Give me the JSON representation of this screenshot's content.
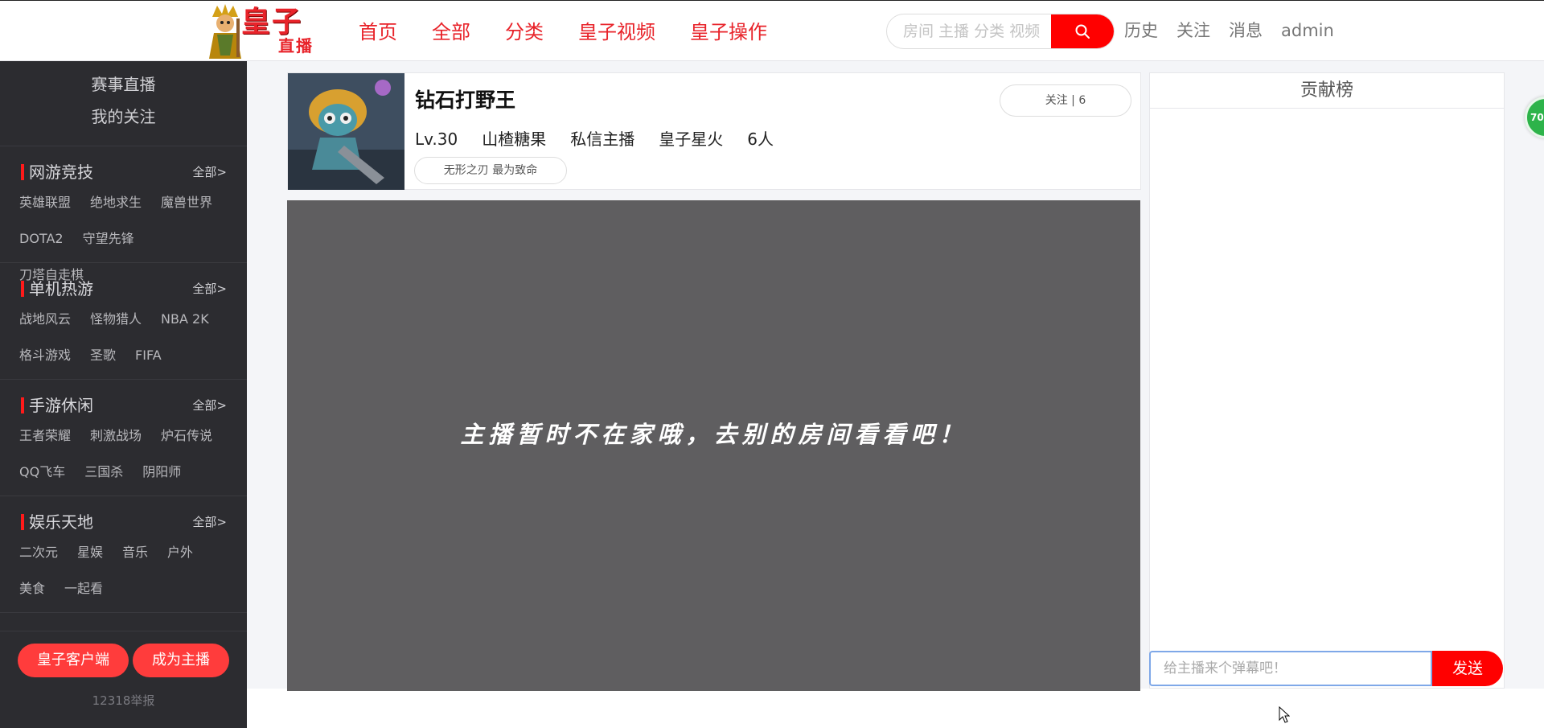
{
  "header": {
    "logo_text_big": "皇子",
    "logo_text_small": "直播",
    "nav": [
      "首页",
      "全部",
      "分类",
      "皇子视频",
      "皇子操作"
    ],
    "search_placeholder": "房间 主播 分类 视频",
    "user_links": [
      "历史",
      "关注",
      "消息",
      "admin"
    ]
  },
  "sidebar": {
    "top_items": [
      "赛事直播",
      "我的关注"
    ],
    "sections": [
      {
        "title": "网游竞技",
        "all_label": "全部>",
        "games": [
          "英雄联盟",
          "绝地求生",
          "魔兽世界",
          "DOTA2",
          "守望先锋",
          "刀塔自走棋"
        ]
      },
      {
        "title": "单机热游",
        "all_label": "全部>",
        "games": [
          "战地风云",
          "怪物猎人",
          "NBA 2K",
          "格斗游戏",
          "圣歌",
          "FIFA"
        ]
      },
      {
        "title": "手游休闲",
        "all_label": "全部>",
        "games": [
          "王者荣耀",
          "刺激战场",
          "炉石传说",
          "QQ飞车",
          "三国杀",
          "阴阳师"
        ]
      },
      {
        "title": "娱乐天地",
        "all_label": "全部>",
        "games": [
          "二次元",
          "星娱",
          "音乐",
          "户外",
          "美食",
          "一起看"
        ]
      }
    ],
    "client_button": "皇子客户端",
    "anchor_button": "成为主播",
    "report_text": "12318举报"
  },
  "room": {
    "title": "钻石打野王",
    "level": "Lv.30",
    "anchor_name": "山楂糖果",
    "message_anchor": "私信主播",
    "fan_badge": "皇子星火",
    "viewers": "6人",
    "tag": "无形之刃 最为致命",
    "follow_label": "关注 | 6"
  },
  "video": {
    "offline_message": "主播暂时不在家哦，去别的房间看看吧！"
  },
  "contribution": {
    "title": "贡献榜"
  },
  "danmu": {
    "placeholder": "给主播来个弹幕吧！",
    "send_label": "发送"
  },
  "badge": {
    "value": "70"
  },
  "colors": {
    "brand_red": "#e8232a",
    "search_red": "#ff0000",
    "sidebar_bg": "#2c2c30",
    "video_bg": "#5f5e60",
    "badge_green": "#2db34a"
  }
}
